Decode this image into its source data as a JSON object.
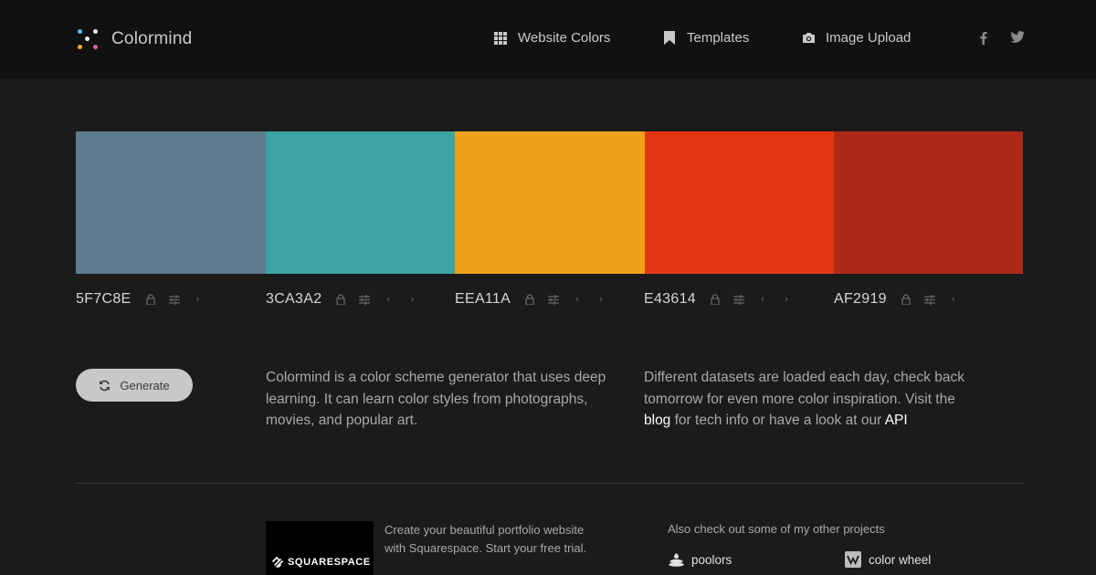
{
  "brand": {
    "name": "Colormind"
  },
  "nav": [
    {
      "label": "Website Colors",
      "icon": "grid-icon"
    },
    {
      "label": "Templates",
      "icon": "bookmark-icon"
    },
    {
      "label": "Image Upload",
      "icon": "camera-icon"
    }
  ],
  "social": [
    {
      "icon": "facebook-icon"
    },
    {
      "icon": "twitter-icon"
    }
  ],
  "palette": [
    {
      "hex": "5F7C8E",
      "color": "#5F7C8E"
    },
    {
      "hex": "3CA3A2",
      "color": "#3CA3A2"
    },
    {
      "hex": "EEA11A",
      "color": "#EEA11A"
    },
    {
      "hex": "E43614",
      "color": "#E43614"
    },
    {
      "hex": "AF2919",
      "color": "#AF2919"
    }
  ],
  "generate": {
    "label": "Generate"
  },
  "intro": {
    "text": "Colormind is a color scheme generator that uses deep learning. It can learn color styles from photographs, movies, and popular art."
  },
  "datasets": {
    "text_before": "Different datasets are loaded each day, check back tomorrow for even more color inspiration. Visit the",
    "blog_link": "blog",
    "text_middle": "for tech info or have a look at our",
    "api_link": "API"
  },
  "ad": {
    "brand": "SQUARESPACE",
    "text": "Create your beautiful portfolio website with Squarespace. Start your free trial."
  },
  "projects": {
    "title": "Also check out some of my other projects",
    "items": [
      {
        "label": "poolors",
        "icon": "poolors-icon"
      },
      {
        "label": "color wheel",
        "icon": "color-wheel-icon"
      }
    ]
  }
}
